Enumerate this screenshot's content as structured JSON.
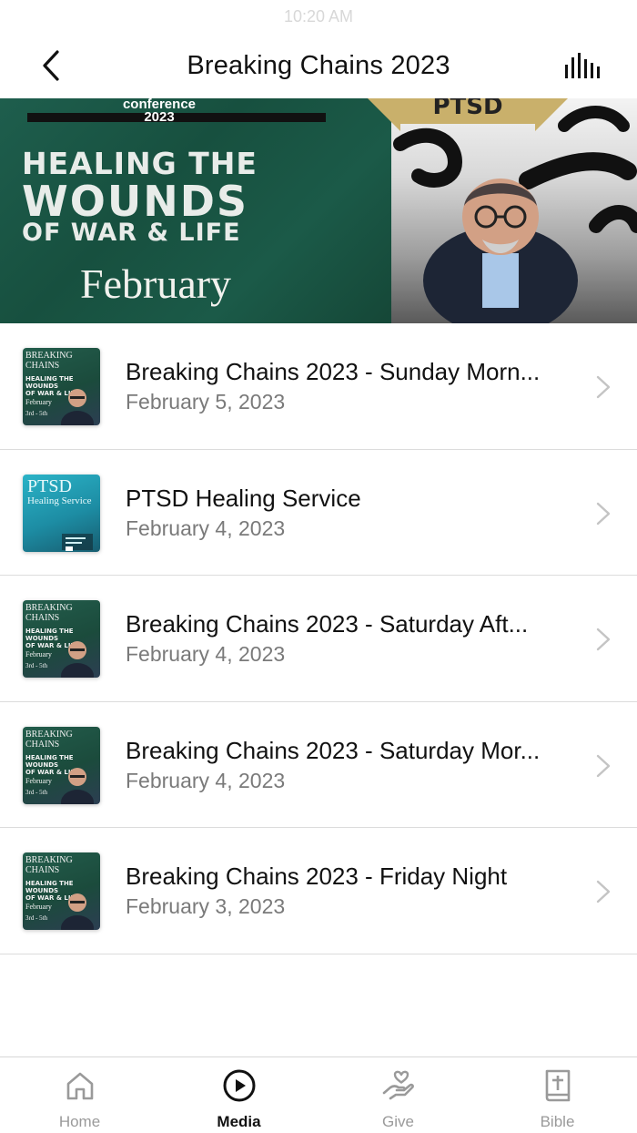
{
  "status_bar": {
    "time": "10:20 AM"
  },
  "nav": {
    "title": "Breaking Chains 2023",
    "back_icon": "chevron-left-icon",
    "action_icon": "audio-bars-icon"
  },
  "hero": {
    "conference_line1": "conference",
    "conference_line2": "2023",
    "headline_line1": "HEALING THE",
    "headline_line2": "WOUNDS",
    "headline_line3": "OF WAR & LIFE",
    "month": "February",
    "badge": "PTSD"
  },
  "media_items": [
    {
      "title": "Breaking Chains 2023 - Sunday Morn...",
      "date": "February 5, 2023",
      "thumb_style": "green"
    },
    {
      "title": "PTSD Healing Service",
      "date": "February 4, 2023",
      "thumb_style": "blue"
    },
    {
      "title": "Breaking Chains 2023 - Saturday Aft...",
      "date": "February 4, 2023",
      "thumb_style": "green"
    },
    {
      "title": "Breaking Chains 2023 - Saturday Mor...",
      "date": "February 4, 2023",
      "thumb_style": "green"
    },
    {
      "title": "Breaking Chains 2023 - Friday Night",
      "date": "February 3, 2023",
      "thumb_style": "green"
    }
  ],
  "thumb_text": {
    "green_line1": "BREAKING",
    "green_line2": "CHAINS",
    "green_line3": "HEALING THE",
    "green_line4": "WOUNDS",
    "green_line5": "OF WAR & LIFE",
    "green_line6": "February",
    "green_line7": "3rd - 5th",
    "blue_line1": "PTSD",
    "blue_line2": "Healing Service"
  },
  "tabs": [
    {
      "label": "Home",
      "icon": "home-icon",
      "active": false
    },
    {
      "label": "Media",
      "icon": "play-circle-icon",
      "active": true
    },
    {
      "label": "Give",
      "icon": "heart-hand-icon",
      "active": false
    },
    {
      "label": "Bible",
      "icon": "bible-icon",
      "active": false
    }
  ],
  "colors": {
    "accent_text": "#111111",
    "inactive_tab": "#9a9a9a",
    "secondary_text": "#7a7a7a",
    "hero_green": "#1e5e4d",
    "badge_gold": "#c9b06b"
  }
}
